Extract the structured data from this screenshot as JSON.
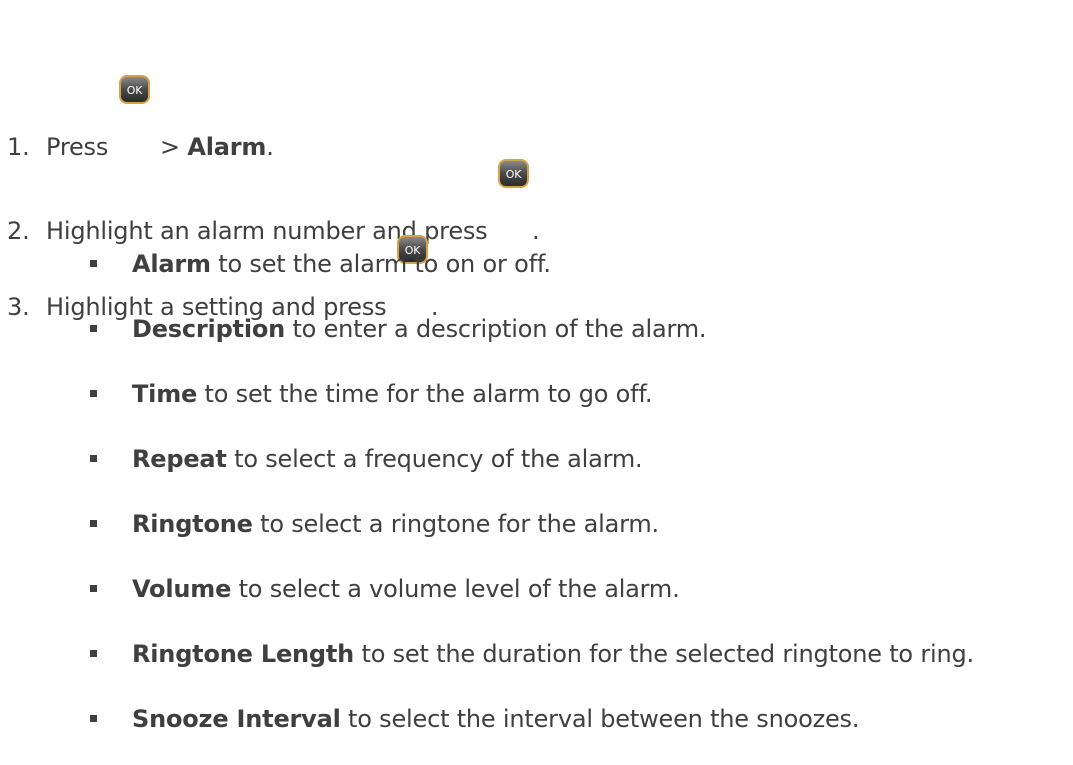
{
  "steps": [
    {
      "num": "1.",
      "pre": "Press",
      "key": "OK",
      "mid": " > ",
      "bold": "Alarm",
      "post": "."
    },
    {
      "num": "2.",
      "pre": "Highlight an alarm number and press",
      "key": "OK",
      "post": "."
    },
    {
      "num": "3.",
      "pre": "Highlight a setting and press",
      "key": "OK",
      "post": "."
    }
  ],
  "settings": [
    {
      "term": "Alarm",
      "desc": " to set the alarm to on or off."
    },
    {
      "term": "Description",
      "desc": " to enter a description of the alarm."
    },
    {
      "term": "Time",
      "desc": " to set the time for the alarm to go off."
    },
    {
      "term": "Repeat",
      "desc": " to select a frequency of the alarm."
    },
    {
      "term": "Ringtone",
      "desc": " to select a ringtone for the alarm."
    },
    {
      "term": "Volume",
      "desc": " to select a volume level of the alarm."
    },
    {
      "term": "Ringtone Length",
      "desc": " to set the duration for the selected ringtone to ring."
    },
    {
      "term": "Snooze Interval",
      "desc": " to select the interval between the snoozes."
    }
  ],
  "icon": "ok-key-icon"
}
